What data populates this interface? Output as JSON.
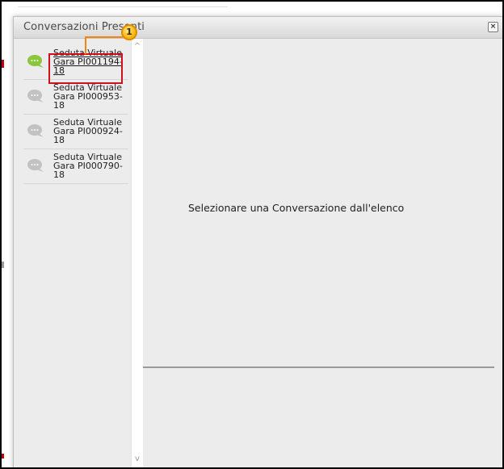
{
  "dialog": {
    "title": "Conversazioni Presenti",
    "close_label": "×"
  },
  "conversations": [
    {
      "label": "Seduta Virtuale Gara PI001194-18",
      "active": true
    },
    {
      "label": "Seduta Virtuale Gara PI000953-18",
      "active": false
    },
    {
      "label": "Seduta Virtuale Gara PI000924-18",
      "active": false
    },
    {
      "label": "Seduta Virtuale Gara PI000790-18",
      "active": false
    }
  ],
  "content": {
    "placeholder": "Selezionare una Conversazione dall'elenco"
  },
  "scrollbar": {
    "up_arrow": "^",
    "down_arrow": "v"
  },
  "callout": {
    "number": "1"
  },
  "colors": {
    "active_icon": "#8cc63f",
    "inactive_icon": "#c2c2c2",
    "highlight": "#d0101b",
    "callout": "#f0850f"
  }
}
